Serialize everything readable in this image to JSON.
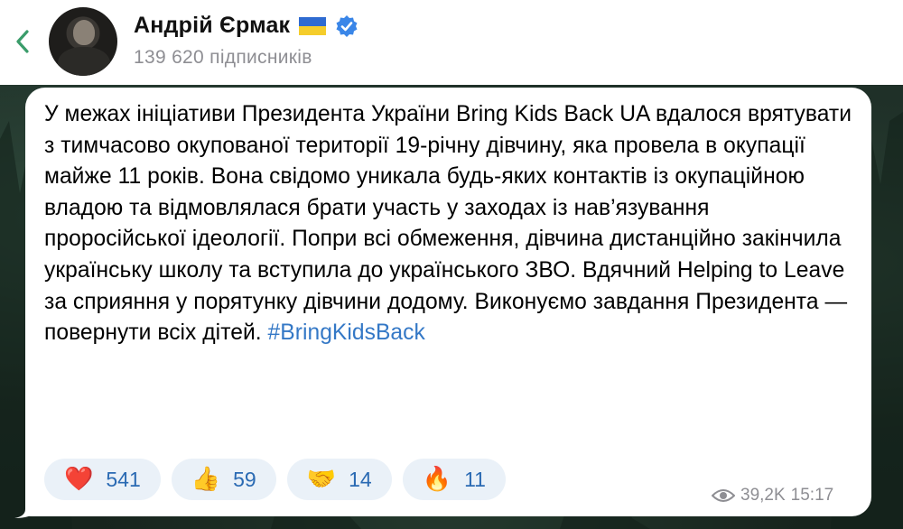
{
  "header": {
    "channel_name": "Андрій Єрмак",
    "subscribers": "139 620 підписників",
    "flag_colors": [
      "#2f6bd1",
      "#f5cd2b"
    ],
    "verified_color": "#3a86e8",
    "back_icon": "chevron-left-icon"
  },
  "message": {
    "text": "У межах ініціативи Президента України Bring Kids Back UA вдалося врятувати з тимчасово окупованої території 19-річну дівчину, яка провела в окупації майже 11 років. Вона свідомо уникала будь-яких контактів із окупаційною владою та відмовлялася брати участь у заходах із нав’язування проросійської ідеології. Попри всі обмеження, дівчина дистанційно закінчила українську школу та вступила до українського ЗВО.  Вдячний Helping to Leave за сприяння у порятунку дівчини додому. Виконуємо завдання Президента — повернути всіх дітей.",
    "hashtag": "#BringKidsBack",
    "hashtag_color": "#3478c6",
    "views": "39,2K",
    "time": "15:17",
    "reactions": [
      {
        "emoji": "❤️",
        "icon": "heart-icon",
        "count": "541"
      },
      {
        "emoji": "👍",
        "icon": "thumbs-up-icon",
        "count": "59"
      },
      {
        "emoji": "🤝",
        "icon": "handshake-icon",
        "count": "14"
      },
      {
        "emoji": "🔥",
        "icon": "fire-icon",
        "count": "11"
      }
    ]
  }
}
